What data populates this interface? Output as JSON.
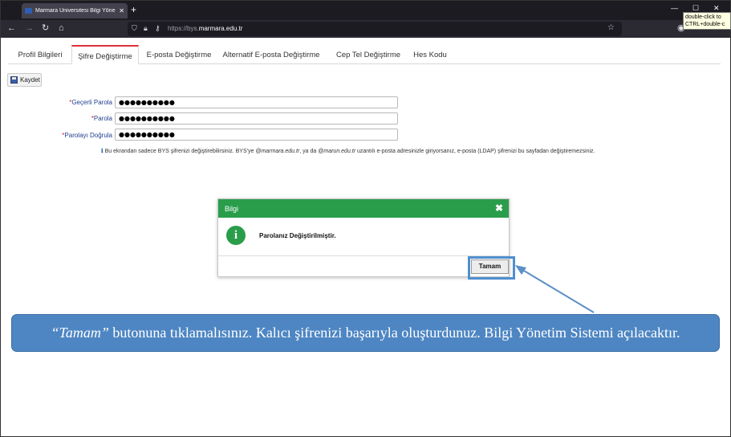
{
  "browser": {
    "tab_title": "Marmara Üniversitesi Bilgi Yöne",
    "tab_close": "✕",
    "new_tab": "+",
    "url_prefix": "https://bys.",
    "url_domain": "marmara.edu.tr",
    "tooltip_line1": "double-click to",
    "tooltip_line2": "CTRL+double-c"
  },
  "tabs": [
    {
      "label": "Profil Bilgileri"
    },
    {
      "label": "Şifre Değiştirme"
    },
    {
      "label": "E-posta Değiştirme"
    },
    {
      "label": "Alternatif E-posta Değiştirme"
    },
    {
      "label": "Cep Tel Değiştirme"
    },
    {
      "label": "Hes Kodu"
    }
  ],
  "toolbar": {
    "save_label": "Kaydet"
  },
  "form": {
    "required_mark": "*",
    "current_password_label": "Geçerli Parola",
    "current_password_value": "●●●●●●●●●●",
    "password_label": "Parola",
    "password_value": "●●●●●●●●●●",
    "confirm_password_label": "Parolayı Doğrula",
    "confirm_password_value": "●●●●●●●●●●"
  },
  "info": {
    "icon": "ℹ",
    "text1": " Bu ekrandan sadece BYS şifrenizi değiştirebilirsiniz. BYS'ye ",
    "domain1": "@marmara.edu.tr",
    "text2": ", ya da ",
    "domain2": "@marun.edu.tr",
    "text3": " uzantılı e-posta adresinizle giriyorsanız, e-posta (LDAP) şifrenizi bu sayfadan değiştiremezsiniz."
  },
  "dialog": {
    "title": "Bilgi",
    "close": "✖",
    "icon": "i",
    "message": "Parolanız Değiştirilmiştir.",
    "ok_label": "Tamam"
  },
  "callout": {
    "quoted": "“Tamam”",
    "text": " butonuna tıklamalısınız. Kalıcı şifrenizi başarıyla oluşturdunuz. Bilgi Yönetim Sistemi açılacaktır."
  },
  "colors": {
    "dialog_header": "#2a9d4b",
    "callout": "#4e86c3",
    "active_tab_accent": "#e0303a"
  }
}
